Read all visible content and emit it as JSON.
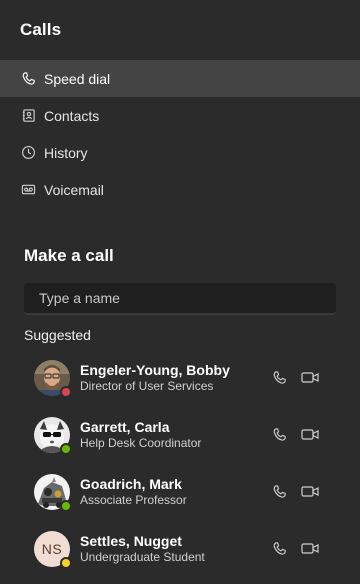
{
  "header": {
    "title": "Calls"
  },
  "nav": [
    {
      "label": "Speed dial",
      "icon": "phone-icon",
      "active": true
    },
    {
      "label": "Contacts",
      "icon": "contacts-icon",
      "active": false
    },
    {
      "label": "History",
      "icon": "clock-icon",
      "active": false
    },
    {
      "label": "Voicemail",
      "icon": "voicemail-icon",
      "active": false
    }
  ],
  "make_call": {
    "title": "Make a call",
    "search_placeholder": "Type a name"
  },
  "suggested": {
    "label": "Suggested",
    "contacts": [
      {
        "name": "Engeler-Young, Bobby",
        "role": "Director of User Services",
        "presence": "busy",
        "presence_color": "#d74654"
      },
      {
        "name": "Garrett, Carla",
        "role": "Help Desk Coordinator",
        "presence": "available",
        "presence_color": "#6bb700"
      },
      {
        "name": "Goadrich, Mark",
        "role": "Associate Professor",
        "presence": "available",
        "presence_color": "#6bb700"
      },
      {
        "name": "Settles, Nugget",
        "role": "Undergraduate Student",
        "presence": "away",
        "presence_color": "#f8d22a",
        "initials": "NS"
      }
    ]
  },
  "colors": {
    "background": "#2b2b2b",
    "active_nav": "#444444",
    "search_bg": "#1f1f1f"
  }
}
